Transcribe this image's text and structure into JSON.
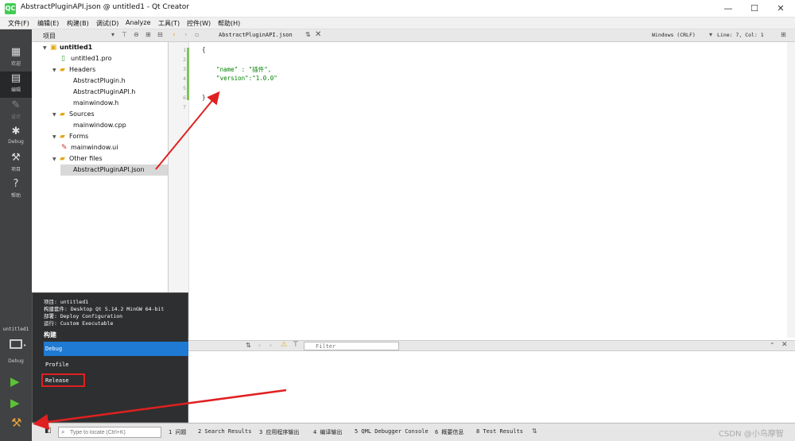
{
  "window": {
    "title": "AbstractPluginAPI.json @ untitled1 - Qt Creator",
    "app_icon": "QC",
    "minimize": "—",
    "maximize": "☐",
    "close": "✕"
  },
  "menubar": [
    "文件(F)",
    "编辑(E)",
    "构建(B)",
    "调试(D)",
    "Analyze",
    "工具(T)",
    "控件(W)",
    "帮助(H)"
  ],
  "modes": [
    {
      "label": "欢迎",
      "icon": "grid-icon"
    },
    {
      "label": "编辑",
      "icon": "edit-icon"
    },
    {
      "label": "设计",
      "icon": "pencil-icon"
    },
    {
      "label": "Debug",
      "icon": "bug-icon"
    },
    {
      "label": "项目",
      "icon": "wrench-icon"
    },
    {
      "label": "帮助",
      "icon": "help-icon"
    }
  ],
  "project_panel": {
    "title": "项目"
  },
  "tree": [
    {
      "label": "untitled1",
      "bold": true,
      "indent": 0,
      "expanded": true,
      "icon": "project-icon"
    },
    {
      "label": "untitled1.pro",
      "indent": 1,
      "icon": "pro-file-icon"
    },
    {
      "label": "Headers",
      "indent": 1,
      "expanded": true,
      "icon": "folder-icon"
    },
    {
      "label": "AbstractPlugin.h",
      "indent": 2,
      "icon": "header-file-icon"
    },
    {
      "label": "AbstractPluginAPI.h",
      "indent": 2,
      "icon": "header-file-icon"
    },
    {
      "label": "mainwindow.h",
      "indent": 2,
      "icon": "header-file-icon"
    },
    {
      "label": "Sources",
      "indent": 1,
      "expanded": true,
      "icon": "folder-icon"
    },
    {
      "label": "mainwindow.cpp",
      "indent": 2,
      "icon": "cpp-file-icon"
    },
    {
      "label": "Forms",
      "indent": 1,
      "expanded": true,
      "icon": "folder-icon"
    },
    {
      "label": "mainwindow.ui",
      "indent": 2,
      "icon": "ui-file-icon"
    },
    {
      "label": "Other files",
      "indent": 1,
      "expanded": true,
      "icon": "folder-icon"
    },
    {
      "label": "AbstractPluginAPI.json",
      "indent": 2,
      "selected": true,
      "icon": "json-file-icon"
    }
  ],
  "editor": {
    "filename": "AbstractPluginAPI.json",
    "encoding": "Windows (CRLF)",
    "cursor": "Line: 7, Col: 1",
    "lines": [
      "{",
      "",
      "    \"name\" : \"插件\",",
      "    \"version\":\"1.0.0\"",
      "",
      "}",
      ""
    ],
    "line_numbers": [
      "1",
      "2",
      "3",
      "4",
      "5",
      "6",
      "7"
    ]
  },
  "output": {
    "filter_placeholder": "Filter"
  },
  "kit_popup": {
    "info": [
      "项目: untitled1",
      "构建套件: Desktop Qt 5.14.2 MinGW 64-bit",
      "部署: Deploy Configuration",
      "运行: Custom Executable"
    ],
    "section": "构建",
    "options": [
      "Debug",
      "Profile",
      "Release"
    ]
  },
  "kit_selector": {
    "project": "untitled1",
    "config": "Debug"
  },
  "locator": {
    "placeholder": "Type to locate (Ctrl+K)"
  },
  "output_tabs": [
    "1 问题",
    "2 Search Results",
    "3 应用程序输出",
    "4 编译输出",
    "5 QML Debugger Console",
    "6 概要信息",
    "8 Test Results"
  ],
  "watermark": "CSDN @小鸟摩智",
  "colors": {
    "json_key": "#008000",
    "json_string": "#008000",
    "selection": "#1e7ad3",
    "annotation": "#e02020",
    "modebar": "#404244"
  }
}
